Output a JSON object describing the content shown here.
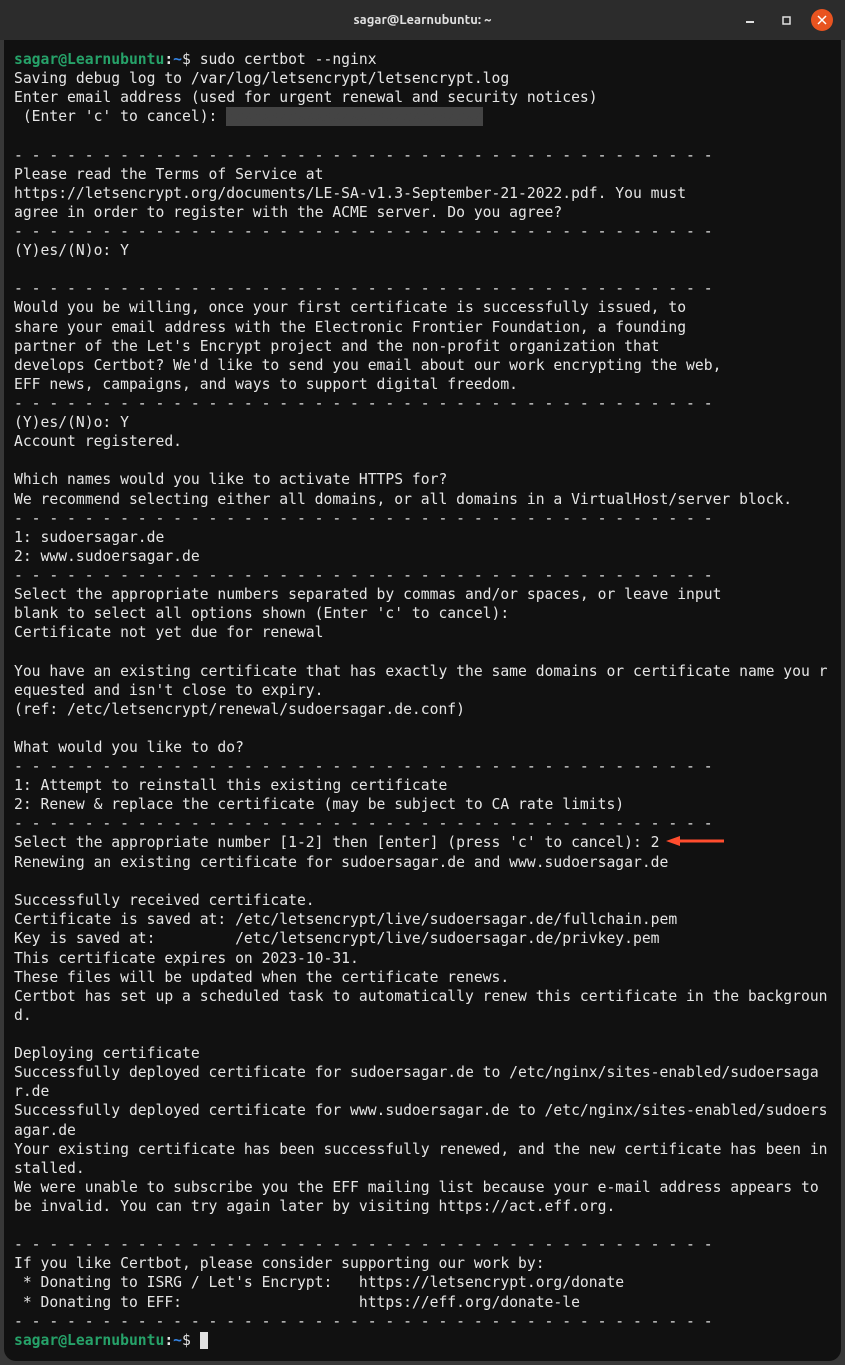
{
  "titlebar": {
    "title": "sagar@Learnubuntu: ~"
  },
  "prompt": {
    "user_host": "sagar@Learnubuntu",
    "colon": ":",
    "path": "~",
    "dollar": "$"
  },
  "command": "sudo certbot --nginx",
  "lines": {
    "l1": "Saving debug log to /var/log/letsencrypt/letsencrypt.log",
    "l2": "Enter email address (used for urgent renewal and security notices)",
    "l3a": " (Enter 'c' to cancel): ",
    "l3_redacted": "xxxxxxxxxxxxxxxxxxxxxxxxxxxxx",
    "sep": "- - - - - - - - - - - - - - - - - - - - - - - - - - - - - - - - - - - - - - - -",
    "l5": "Please read the Terms of Service at",
    "l6": "https://letsencrypt.org/documents/LE-SA-v1.3-September-21-2022.pdf. You must",
    "l7": "agree in order to register with the ACME server. Do you agree?",
    "l9": "(Y)es/(N)o: Y",
    "l11": "Would you be willing, once your first certificate is successfully issued, to",
    "l12": "share your email address with the Electronic Frontier Foundation, a founding",
    "l13": "partner of the Let's Encrypt project and the non-profit organization that",
    "l14": "develops Certbot? We'd like to send you email about our work encrypting the web,",
    "l15": "EFF news, campaigns, and ways to support digital freedom.",
    "l17": "(Y)es/(N)o: Y",
    "l18": "Account registered.",
    "l20": "Which names would you like to activate HTTPS for?",
    "l21": "We recommend selecting either all domains, or all domains in a VirtualHost/server block.",
    "l23": "1: sudoersagar.de",
    "l24": "2: www.sudoersagar.de",
    "l26": "Select the appropriate numbers separated by commas and/or spaces, or leave input",
    "l27": "blank to select all options shown (Enter 'c' to cancel): ",
    "l28": "Certificate not yet due for renewal",
    "l30": "You have an existing certificate that has exactly the same domains or certificate name you requested and isn't close to expiry.",
    "l31": "(ref: /etc/letsencrypt/renewal/sudoersagar.de.conf)",
    "l33": "What would you like to do?",
    "l35": "1: Attempt to reinstall this existing certificate",
    "l36": "2: Renew & replace the certificate (may be subject to CA rate limits)",
    "l38": "Select the appropriate number [1-2] then [enter] (press 'c' to cancel): 2",
    "l39": "Renewing an existing certificate for sudoersagar.de and www.sudoersagar.de",
    "l41": "Successfully received certificate.",
    "l42": "Certificate is saved at: /etc/letsencrypt/live/sudoersagar.de/fullchain.pem",
    "l43": "Key is saved at:         /etc/letsencrypt/live/sudoersagar.de/privkey.pem",
    "l44": "This certificate expires on 2023-10-31.",
    "l45": "These files will be updated when the certificate renews.",
    "l46": "Certbot has set up a scheduled task to automatically renew this certificate in the background.",
    "l48": "Deploying certificate",
    "l49": "Successfully deployed certificate for sudoersagar.de to /etc/nginx/sites-enabled/sudoersagar.de",
    "l50": "Successfully deployed certificate for www.sudoersagar.de to /etc/nginx/sites-enabled/sudoersagar.de",
    "l51": "Your existing certificate has been successfully renewed, and the new certificate has been installed.",
    "l52": "We were unable to subscribe you the EFF mailing list because your e-mail address appears to be invalid. You can try again later by visiting https://act.eff.org.",
    "l54": "If you like Certbot, please consider supporting our work by:",
    "l55": " * Donating to ISRG / Let's Encrypt:   https://letsencrypt.org/donate",
    "l56": " * Donating to EFF:                    https://eff.org/donate-le"
  }
}
